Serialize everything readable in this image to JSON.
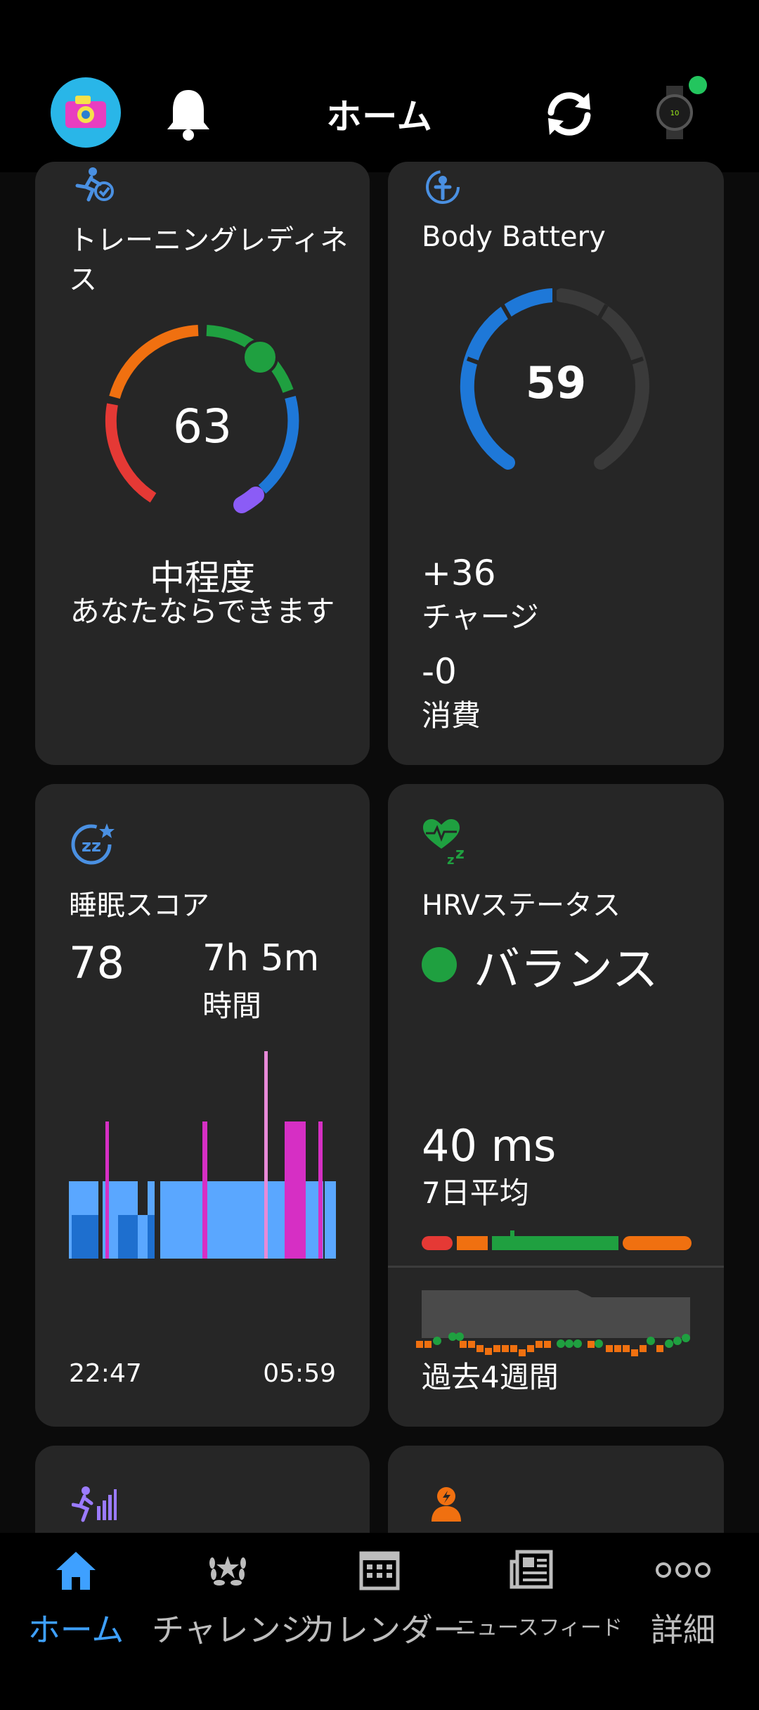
{
  "header": {
    "title": "ホーム"
  },
  "training_readiness": {
    "title": "トレーニングレディネス",
    "score": "63",
    "level": "中程度",
    "message": "あなたならできます"
  },
  "body_battery": {
    "title": "Body Battery",
    "value": "59",
    "charge_value": "+36",
    "charge_label": "チャージ",
    "drain_value": "-0",
    "drain_label": "消費"
  },
  "sleep": {
    "title": "睡眠スコア",
    "score": "78",
    "duration": "7h 5m",
    "duration_label": "時間",
    "start_time": "22:47",
    "end_time": "05:59"
  },
  "hrv": {
    "title": "HRVステータス",
    "status": "バランス",
    "average": "40 ms",
    "average_label": "7日平均",
    "period_label": "過去4週間"
  },
  "tabs": [
    {
      "label": "ホーム",
      "icon": "home-icon",
      "active": true
    },
    {
      "label": "チャレンジ",
      "icon": "laurel-icon",
      "active": false
    },
    {
      "label": "カレンダー",
      "icon": "calendar-icon",
      "active": false
    },
    {
      "label": "ニュースフィード",
      "icon": "newsfeed-icon",
      "active": false
    },
    {
      "label": "詳細",
      "icon": "more-icon",
      "active": false
    }
  ],
  "colors": {
    "accent": "#3ea0ff",
    "card": "#262626",
    "green": "#1fa040",
    "orange": "#f07010",
    "red": "#e53935",
    "blue": "#1e78d8",
    "purple": "#8b5cf6",
    "magenta": "#d62fc4"
  }
}
